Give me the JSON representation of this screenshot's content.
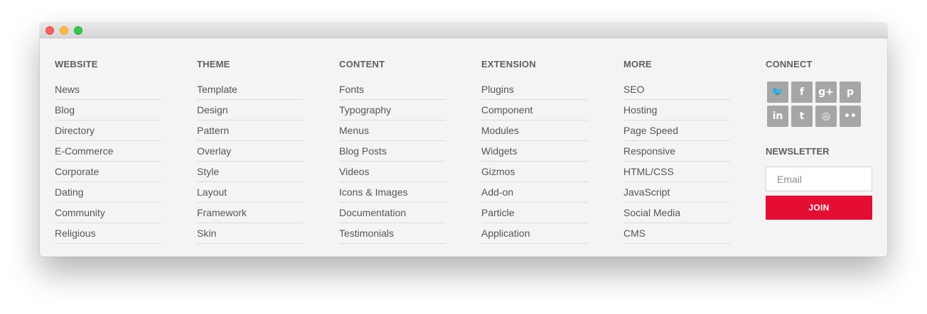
{
  "columns": [
    {
      "title": "WEBSITE",
      "links": [
        "News",
        "Blog",
        "Directory",
        "E-Commerce",
        "Corporate",
        "Dating",
        "Community",
        "Religious"
      ]
    },
    {
      "title": "THEME",
      "links": [
        "Template",
        "Design",
        "Pattern",
        "Overlay",
        "Style",
        "Layout",
        "Framework",
        "Skin"
      ]
    },
    {
      "title": "CONTENT",
      "links": [
        "Fonts",
        "Typography",
        "Menus",
        "Blog Posts",
        "Videos",
        "Icons & Images",
        "Documentation",
        "Testimonials"
      ]
    },
    {
      "title": "EXTENSION",
      "links": [
        "Plugins",
        "Component",
        "Modules",
        "Widgets",
        "Gizmos",
        "Add-on",
        "Particle",
        "Application"
      ]
    },
    {
      "title": "MORE",
      "links": [
        "SEO",
        "Hosting",
        "Page Speed",
        "Responsive",
        "HTML/CSS",
        "JavaScript",
        "Social Media",
        "CMS"
      ]
    }
  ],
  "connect": {
    "title": "CONNECT",
    "social": [
      {
        "icon": "twitter-icon",
        "glyph": "🐦"
      },
      {
        "icon": "facebook-icon",
        "glyph": "f"
      },
      {
        "icon": "google-plus-icon",
        "glyph": "g+"
      },
      {
        "icon": "pinterest-icon",
        "glyph": "p"
      },
      {
        "icon": "linkedin-icon",
        "glyph": "in"
      },
      {
        "icon": "tumblr-icon",
        "glyph": "t"
      },
      {
        "icon": "instagram-icon",
        "glyph": "◎"
      },
      {
        "icon": "flickr-icon",
        "glyph": "••"
      }
    ]
  },
  "newsletter": {
    "title": "NEWSLETTER",
    "email_placeholder": "Email",
    "join_label": "JOIN"
  },
  "colors": {
    "accent": "#e40d32",
    "social_bg": "#a6a6a6"
  }
}
